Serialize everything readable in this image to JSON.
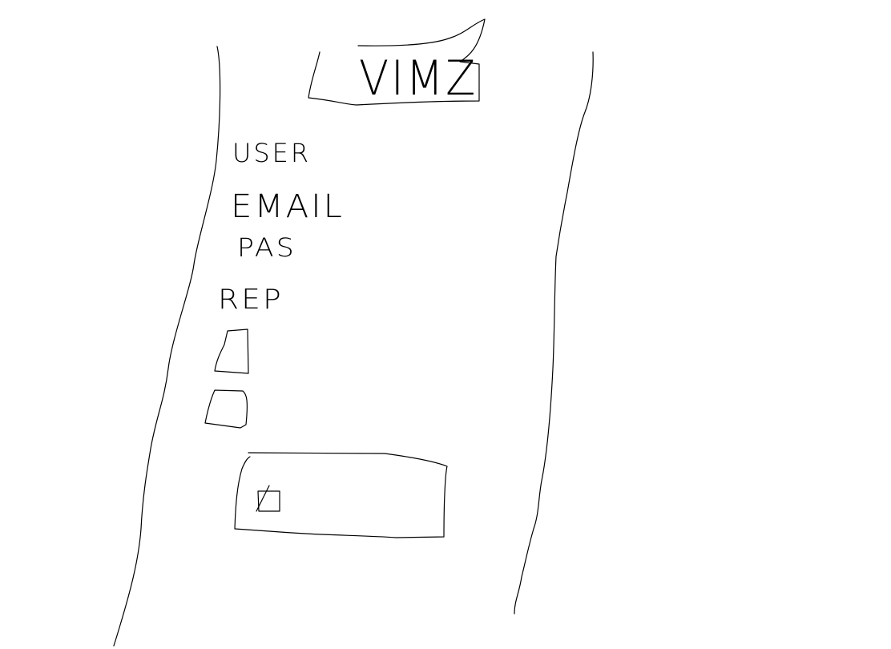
{
  "header": {
    "logo_text": "VIMZ"
  },
  "form": {
    "user_label": "USER",
    "email_label": "EMAIL",
    "pass_label": "PAS",
    "rep_label": "REP"
  },
  "colors": {
    "background": "#ffffff",
    "ink": "#000000"
  }
}
